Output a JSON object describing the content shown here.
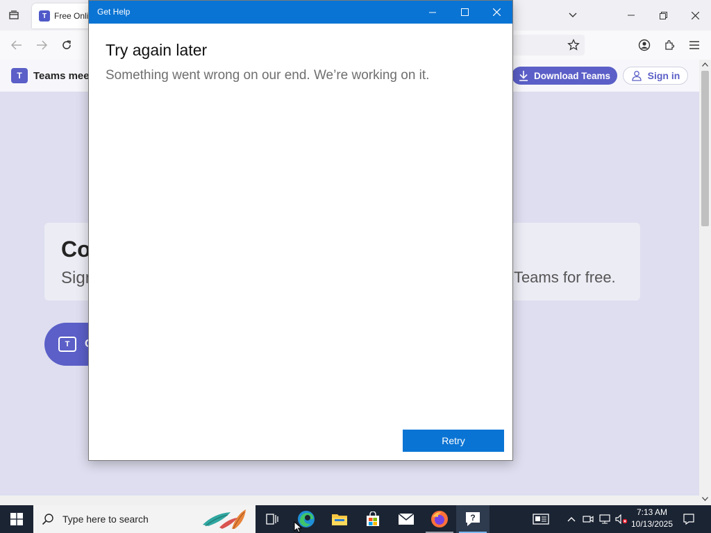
{
  "browser": {
    "tab_title": "Free Onlin",
    "tab_icon_letter": "T"
  },
  "page": {
    "brand": "Teams mee",
    "download_label": "Download Teams",
    "signin_label": "Sign in",
    "hero_title": "Co",
    "hero_sub_left": "Sign",
    "hero_sub_right": "n Teams for free.",
    "cta_label": "C"
  },
  "dialog": {
    "title": "Get Help",
    "heading": "Try again later",
    "message": "Something went wrong on our end. We’re working on it.",
    "retry_label": "Retry"
  },
  "taskbar": {
    "search_placeholder": "Type here to search",
    "time": "7:13 AM",
    "date": "10/13/2025"
  },
  "colors": {
    "dialog_accent": "#0a74d4",
    "teams_purple": "#5b5fc7",
    "taskbar": "#1b2433"
  }
}
